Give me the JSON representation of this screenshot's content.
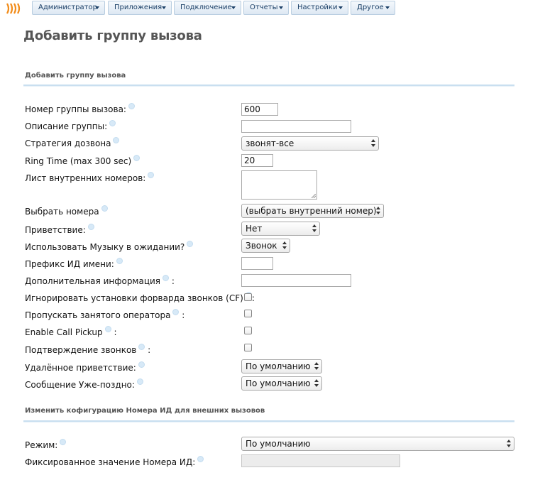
{
  "nav": {
    "items": [
      {
        "label": "Администратор"
      },
      {
        "label": "Приложения"
      },
      {
        "label": "Подключение"
      },
      {
        "label": "Отчеты"
      },
      {
        "label": "Настройки"
      },
      {
        "label": "Другое"
      }
    ]
  },
  "page": {
    "title": "Добавить группу вызова"
  },
  "section1": {
    "title": "Добавить группу вызова"
  },
  "form": {
    "group_number": {
      "label": "Номер группы вызова:",
      "value": "600"
    },
    "group_description": {
      "label": "Описание группы:",
      "value": ""
    },
    "ring_strategy": {
      "label": "Стратегия дозвона",
      "value": "звонят-все"
    },
    "ring_time": {
      "label": "Ring Time (max 300 sec)",
      "value": "20"
    },
    "extension_list": {
      "label": "Лист внутренних номеров:",
      "value": ""
    },
    "select_number": {
      "label": "Выбрать номера",
      "value": "(выбрать внутренний номер)"
    },
    "announcement": {
      "label": "Приветствие:",
      "value": "Нет"
    },
    "music_on_hold": {
      "label": "Использовать Музыку в ожидании?",
      "value": "Звонок"
    },
    "cid_prefix": {
      "label": "Префикс ИД имени:",
      "value": ""
    },
    "alert_info": {
      "label": "Дополнительная информация",
      "value": ""
    },
    "ignore_cf": {
      "label": "Игнорировать установки форварда звонков (CF)",
      "checked": false
    },
    "skip_busy": {
      "label": "Пропускать занятого оператора",
      "checked": false
    },
    "call_pickup": {
      "label": "Enable Call Pickup",
      "checked": false
    },
    "confirm_calls": {
      "label": "Подтверждение звонков",
      "checked": false
    },
    "remote_announce": {
      "label": "Удалённое приветствие:",
      "value": "По умолчанию"
    },
    "too_late_announce": {
      "label": "Сообщение Уже-поздно:",
      "value": "По умолчанию"
    }
  },
  "section2": {
    "title": "Изменить кофигурацию Номера ИД для внешних вызовов"
  },
  "cid": {
    "mode": {
      "label": "Режим:",
      "value": "По умолчанию"
    },
    "fixed_value": {
      "label": "Фиксированное значение Номера ИД:",
      "value": ""
    }
  },
  "colors": {
    "accent": "#c9dff0",
    "nav_text": "#1a3f66",
    "logo": "#f28c1a"
  }
}
